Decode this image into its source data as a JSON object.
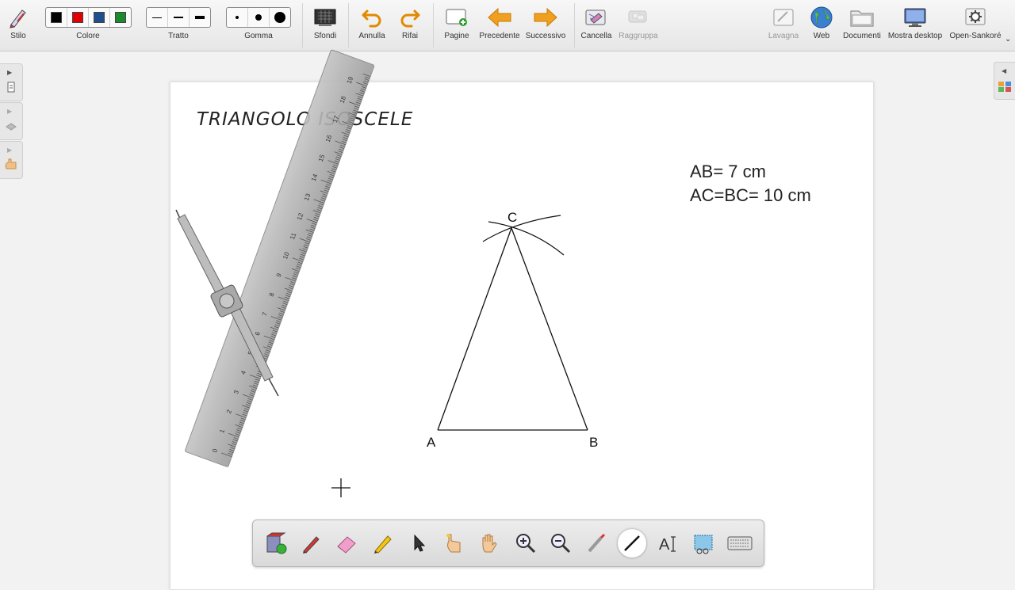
{
  "toolbar": {
    "pen_label": "Stilo",
    "color_label": "Colore",
    "stroke_label": "Tratto",
    "eraser_label": "Gomma",
    "backgrounds_label": "Sfondi",
    "undo_label": "Annulla",
    "redo_label": "Rifai",
    "pages_label": "Pagine",
    "previous_label": "Precedente",
    "next_label": "Successivo",
    "delete_label": "Cancella",
    "group_label": "Raggruppa",
    "board_label": "Lavagna",
    "web_label": "Web",
    "documents_label": "Documenti",
    "show_desktop_label": "Mostra desktop",
    "app_label": "Open-Sankoré",
    "colors": [
      "#000000",
      "#e00000",
      "#1f4e8c",
      "#1a8a2a"
    ]
  },
  "page": {
    "title": "TRIANGOLO ISOSCELE",
    "measure_ab": "AB= 7 cm",
    "measure_acbc": "AC=BC= 10 cm",
    "vertex_a": "A",
    "vertex_b": "B",
    "vertex_c": "C"
  },
  "ruler": {
    "labels": [
      "0",
      "1",
      "2",
      "3",
      "4",
      "5",
      "6",
      "7",
      "8",
      "9",
      "10",
      "11",
      "12",
      "13",
      "14",
      "15",
      "16",
      "17",
      "18",
      "19"
    ]
  },
  "bottom_tools": [
    "color-picker-icon",
    "pen-icon",
    "eraser-icon",
    "highlighter-icon",
    "pointer-icon",
    "hand-pointer-icon",
    "pan-hand-icon",
    "zoom-in-icon",
    "zoom-out-icon",
    "laser-pointer-icon",
    "line-icon",
    "text-icon",
    "capture-icon",
    "keyboard-icon"
  ]
}
